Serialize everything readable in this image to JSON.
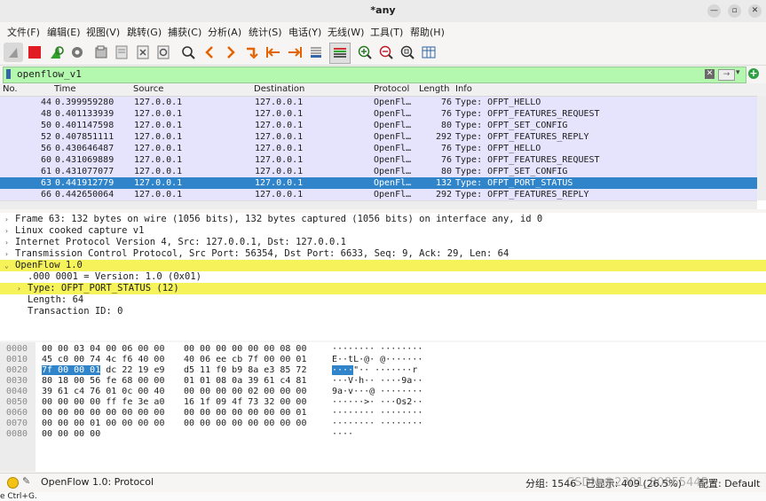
{
  "window": {
    "title": "*any"
  },
  "menubar": [
    "文件(F)",
    "编辑(E)",
    "视图(V)",
    "跳转(G)",
    "捕获(C)",
    "分析(A)",
    "统计(S)",
    "电话(Y)",
    "无线(W)",
    "工具(T)",
    "帮助(H)"
  ],
  "toolbar": {
    "icons": [
      "shark-fin-start-icon",
      "stop-icon",
      "restart-icon",
      "options-gear-icon",
      "open-file-icon",
      "save-file-icon",
      "close-file-icon",
      "reload-icon",
      "find-icon",
      "back-icon",
      "forward-icon",
      "goto-icon",
      "first-icon",
      "last-icon",
      "autoscroll-icon",
      "colorize-icon",
      "zoom-in-icon",
      "zoom-out-icon",
      "zoom-normal-icon",
      "resize-columns-icon"
    ]
  },
  "filter": {
    "value": "openflow_v1"
  },
  "packet_list": {
    "columns": [
      "No.",
      "Time",
      "Source",
      "Destination",
      "Protocol",
      "Length",
      "Info"
    ],
    "rows": [
      {
        "no": "44",
        "time": "0.399959280",
        "src": "127.0.0.1",
        "dst": "127.0.0.1",
        "proto": "OpenFl…",
        "len": "76",
        "info": "Type: OFPT_HELLO",
        "selected": false
      },
      {
        "no": "48",
        "time": "0.401133939",
        "src": "127.0.0.1",
        "dst": "127.0.0.1",
        "proto": "OpenFl…",
        "len": "76",
        "info": "Type: OFPT_FEATURES_REQUEST",
        "selected": false
      },
      {
        "no": "50",
        "time": "0.401147598",
        "src": "127.0.0.1",
        "dst": "127.0.0.1",
        "proto": "OpenFl…",
        "len": "80",
        "info": "Type: OFPT_SET_CONFIG",
        "selected": false
      },
      {
        "no": "52",
        "time": "0.407851111",
        "src": "127.0.0.1",
        "dst": "127.0.0.1",
        "proto": "OpenFl…",
        "len": "292",
        "info": "Type: OFPT_FEATURES_REPLY",
        "selected": false
      },
      {
        "no": "56",
        "time": "0.430646487",
        "src": "127.0.0.1",
        "dst": "127.0.0.1",
        "proto": "OpenFl…",
        "len": "76",
        "info": "Type: OFPT_HELLO",
        "selected": false
      },
      {
        "no": "60",
        "time": "0.431069889",
        "src": "127.0.0.1",
        "dst": "127.0.0.1",
        "proto": "OpenFl…",
        "len": "76",
        "info": "Type: OFPT_FEATURES_REQUEST",
        "selected": false
      },
      {
        "no": "61",
        "time": "0.431077077",
        "src": "127.0.0.1",
        "dst": "127.0.0.1",
        "proto": "OpenFl…",
        "len": "80",
        "info": "Type: OFPT_SET_CONFIG",
        "selected": false
      },
      {
        "no": "63",
        "time": "0.441912779",
        "src": "127.0.0.1",
        "dst": "127.0.0.1",
        "proto": "OpenFl…",
        "len": "132",
        "info": "Type: OFPT_PORT_STATUS",
        "selected": true
      },
      {
        "no": "66",
        "time": "0.442650064",
        "src": "127.0.0.1",
        "dst": "127.0.0.1",
        "proto": "OpenFl…",
        "len": "292",
        "info": "Type: OFPT_FEATURES_REPLY",
        "selected": false
      }
    ]
  },
  "details": [
    {
      "text": "Frame 63: 132 bytes on wire (1056 bits), 132 bytes captured (1056 bits) on interface any, id 0",
      "indent": 0,
      "arrow": "›",
      "highlight": false
    },
    {
      "text": "Linux cooked capture v1",
      "indent": 0,
      "arrow": "›",
      "highlight": false
    },
    {
      "text": "Internet Protocol Version 4, Src: 127.0.0.1, Dst: 127.0.0.1",
      "indent": 0,
      "arrow": "›",
      "highlight": false
    },
    {
      "text": "Transmission Control Protocol, Src Port: 56354, Dst Port: 6633, Seq: 9, Ack: 29, Len: 64",
      "indent": 0,
      "arrow": "›",
      "highlight": false
    },
    {
      "text": "OpenFlow 1.0",
      "indent": 0,
      "arrow": "⌄",
      "highlight": true
    },
    {
      "text": ".000 0001 = Version: 1.0 (0x01)",
      "indent": 2,
      "arrow": "",
      "highlight": false
    },
    {
      "text": "Type: OFPT_PORT_STATUS (12)",
      "indent": 1,
      "arrow": "›",
      "highlight": true
    },
    {
      "text": "Length: 64",
      "indent": 1,
      "arrow": "",
      "highlight": false
    },
    {
      "text": "Transaction ID: 0",
      "indent": 1,
      "arrow": "",
      "highlight": false
    }
  ],
  "hex": [
    {
      "off": "0000",
      "b1": "00 00 03 04 00 06 00 00",
      "b2": "00 00 00 00 00 00 08 00",
      "asc": "········ ········"
    },
    {
      "off": "0010",
      "b1": "45 c0 00 74 4c f6 40 00",
      "b2": "40 06 ee cb 7f 00 00 01",
      "asc": "E··tL·@· @·······"
    },
    {
      "off": "0020",
      "b1": "7f 00 00 01 dc 22 19 e9",
      "b2": "d5 11 f0 b9 8a e3 85 72",
      "asc": "····\"·· ·······r"
    },
    {
      "off": "0030",
      "b1": "80 18 00 56 fe 68 00 00",
      "b2": "01 01 08 0a 39 61 c4 81",
      "asc": "···V·h·· ····9a··"
    },
    {
      "off": "0040",
      "b1": "39 61 c4 76 01 0c 00 40",
      "b2": "00 00 00 00 02 00 00 00",
      "asc": "9a·v···@ ········"
    },
    {
      "off": "0050",
      "b1": "00 00 00 00 ff fe 3e a0",
      "b2": "16 1f 09 4f 73 32 00 00",
      "asc": "······>· ···Os2··"
    },
    {
      "off": "0060",
      "b1": "00 00 00 00 00 00 00 00",
      "b2": "00 00 00 00 00 00 00 01",
      "asc": "········ ········"
    },
    {
      "off": "0070",
      "b1": "00 00 00 01 00 00 00 00",
      "b2": "00 00 00 00 00 00 00 00",
      "asc": "········ ········"
    },
    {
      "off": "0080",
      "b1": "00 00 00 00",
      "b2": "",
      "asc": "····"
    }
  ],
  "hex_selection": {
    "b1_prefix": "7f 00 00 01",
    "asc_prefix": "····"
  },
  "status": {
    "protocol": "OpenFlow 1.0: Protocol",
    "stats": "分组: 1546 · 已显示: 409 (26.5%)",
    "profile": "配置: Default",
    "watermark": "CSDN @2301_80855445"
  },
  "bottom_hint": "e Ctrl+G."
}
